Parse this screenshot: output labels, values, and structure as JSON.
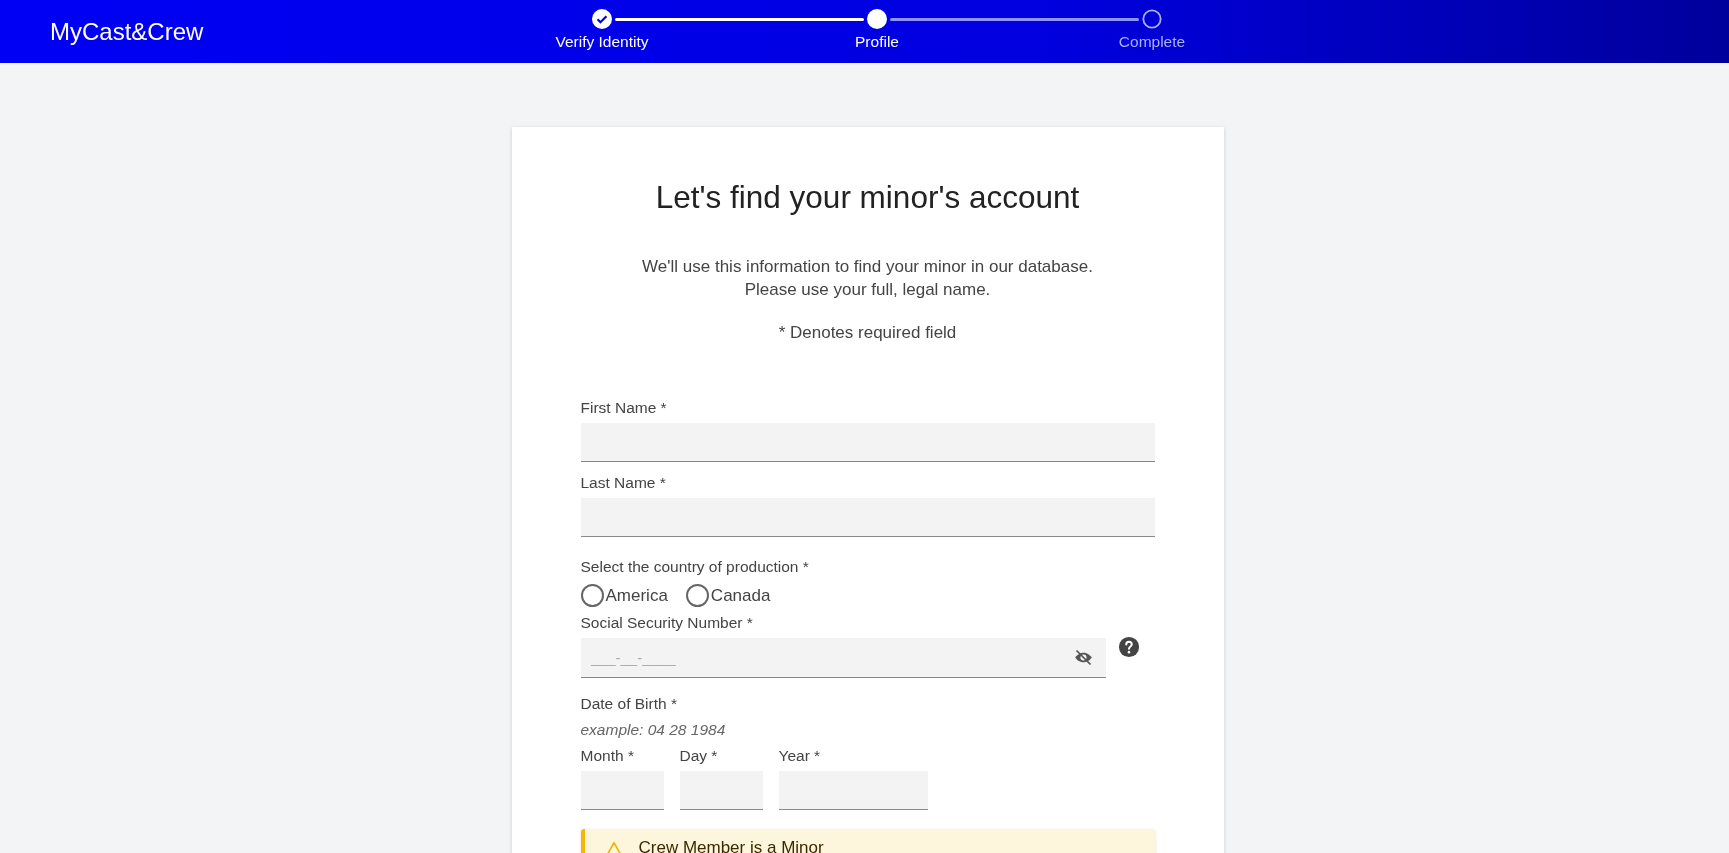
{
  "header": {
    "brand": "MyCast&Crew",
    "steps": [
      {
        "label": "Verify Identity",
        "kind": "completed"
      },
      {
        "label": "Profile",
        "kind": "current"
      },
      {
        "label": "Complete",
        "kind": "upcoming"
      }
    ]
  },
  "card": {
    "title": "Let's find your minor's account",
    "intro": [
      "We'll use this information to find your minor in our database.",
      "Please use your full, legal name."
    ],
    "required_note": "* Denotes required field",
    "first_name": {
      "label": "First Name *"
    },
    "last_name": {
      "label": "Last Name *"
    },
    "country": {
      "label": "Select the country of production *",
      "options": [
        {
          "label": "America",
          "selected": false
        },
        {
          "label": "Canada",
          "selected": false
        }
      ]
    },
    "ssn": {
      "label": "Social Security Number *",
      "placeholder": "___-__-____"
    },
    "dob": {
      "label": "Date of Birth *",
      "example": "example: 04 28 1984",
      "parts": [
        {
          "label": "Month *",
          "kind": "short"
        },
        {
          "label": "Day *",
          "kind": "short"
        },
        {
          "label": "Year *",
          "kind": "long"
        }
      ]
    },
    "alert": {
      "title": "Crew Member is a Minor"
    }
  }
}
